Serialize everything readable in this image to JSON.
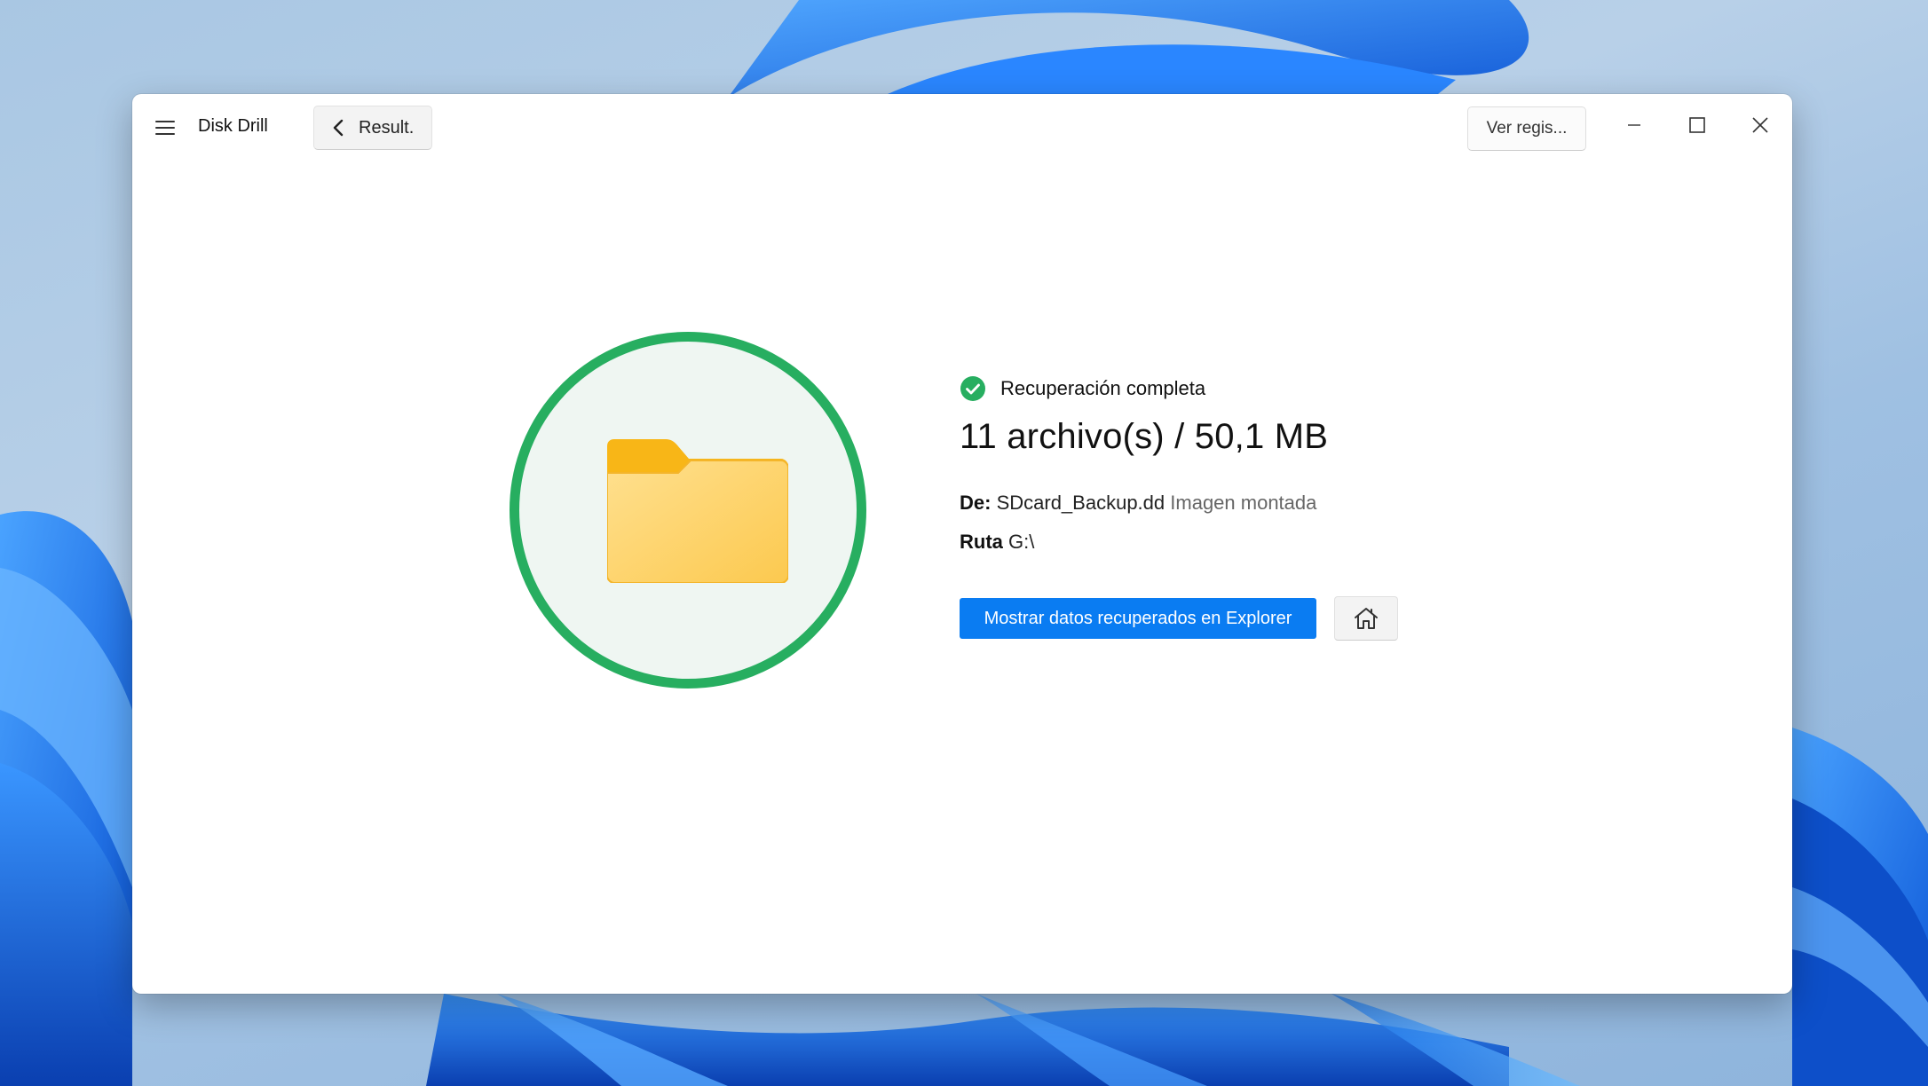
{
  "window": {
    "app_title": "Disk Drill",
    "back_label": "Result.",
    "log_button_label": "Ver regis..."
  },
  "result": {
    "status": "Recuperación completa",
    "summary": "11 archivo(s) / 50,1 MB",
    "source_label": "De:",
    "source_value": "SDcard_Backup.dd",
    "source_type": "Imagen montada",
    "path_label": "Ruta",
    "path_value": "G:\\",
    "primary_action": "Mostrar datos recuperados en Explorer"
  },
  "colors": {
    "accent": "#0a7cf2",
    "success": "#27ae60",
    "folder": "#fcc44a"
  },
  "icons": {
    "menu": "hamburger-icon",
    "back": "chevron-left-icon",
    "minimize": "minimize-icon",
    "maximize": "maximize-icon",
    "close": "close-icon",
    "status": "check-circle-icon",
    "hero": "folder-icon",
    "home": "home-icon"
  }
}
